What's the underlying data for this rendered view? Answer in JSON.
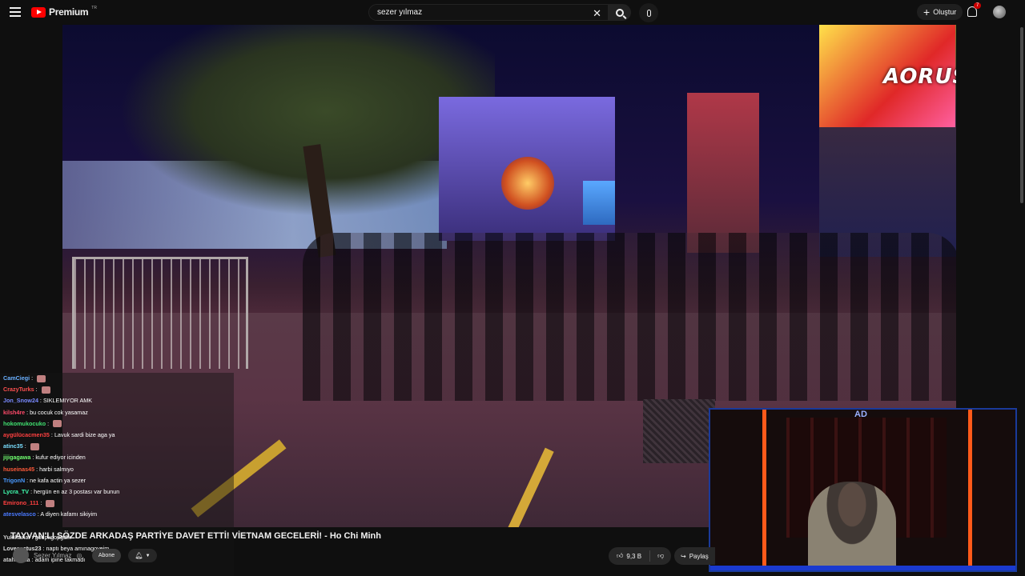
{
  "header": {
    "brand": "Premium",
    "brand_sup": "TR",
    "search_value": "sezer yılmaz",
    "create_label": "Oluştur",
    "notification_count": "7"
  },
  "video": {
    "title": "TAYVAN'LI SÖZDE ARKADAŞ PARTİYE DAVET ETTİ! VİETNAM GECELERİ! - Ho Chi Minh",
    "overlay_brand": "AORUS",
    "cam_logo": "AD"
  },
  "channel": {
    "name": "Sezer Yılmaz",
    "subscribe_label": "Abone"
  },
  "actions": {
    "likes": "9,3 B",
    "share_label": "Paylaş"
  },
  "chat": [
    {
      "user": "CamCiegi",
      "msg": "",
      "color": "#6ab0ff",
      "emote": true
    },
    {
      "user": "CrazyTurks",
      "msg": "",
      "color": "#ff5050",
      "emote": true
    },
    {
      "user": "Jon_Snow24",
      "msg": "SIKLEMIYOR AMK",
      "color": "#7a8aff",
      "emote": false
    },
    {
      "user": "kilsh4re",
      "msg": "bu cocuk cok yasamaz",
      "color": "#ff4a6a",
      "emote": false
    },
    {
      "user": "hokomukocuko",
      "msg": "",
      "color": "#40e070",
      "emote": true
    },
    {
      "user": "aygülücacmen35",
      "msg": "Lavuk sardi bize aga ya",
      "color": "#ff4040",
      "emote": false
    },
    {
      "user": "atinc35",
      "msg": "",
      "color": "#7adfff",
      "emote": true
    },
    {
      "user": "jijigagawa",
      "msg": "kufur ediyor icinden",
      "color": "#70ff70",
      "emote": false
    },
    {
      "user": "huseinas45",
      "msg": "harbi salmıyo",
      "color": "#ff5a3a",
      "emote": false
    },
    {
      "user": "TrigonN",
      "msg": "ne kafa actin ya sezer",
      "color": "#4a9aff",
      "emote": false
    },
    {
      "user": "Lycra_TV",
      "msg": "hergün en az 3 postası var bunun",
      "color": "#40ffb0",
      "emote": false
    },
    {
      "user": "Emirono_111",
      "msg": "",
      "color": "#ff4040",
      "emote": true
    },
    {
      "user": "atesvelasco",
      "msg": "A diyen kafamı sikiyim",
      "color": "#4a7aff",
      "emote": false
    },
    {
      "user": "",
      "msg": "",
      "color": "#ffffff",
      "emote": false
    },
    {
      "user": "Yukihanai",
      "msg": "godpkgopgdfk",
      "color": "#cfcfcf",
      "emote": false
    },
    {
      "user": "Lovecactus23",
      "msg": "naptı beya amınagoyeim",
      "color": "#e0e0e0",
      "emote": false
    },
    {
      "user": "atahanata",
      "msg": "adam ipine takmadı",
      "color": "#d0d0d0",
      "emote": false
    }
  ]
}
